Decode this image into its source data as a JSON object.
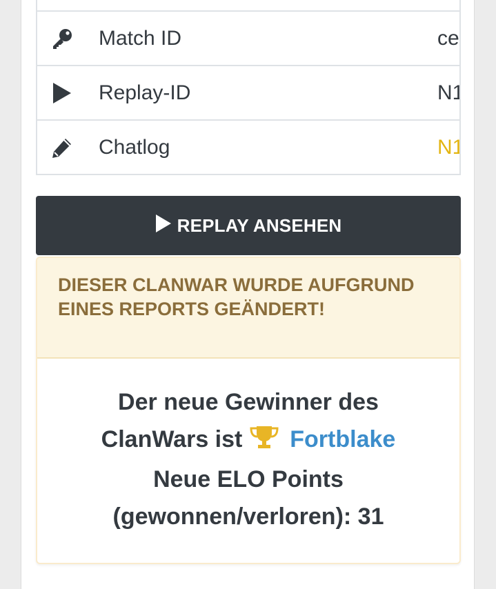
{
  "table": {
    "rows": [
      {
        "icon": "key-icon",
        "label": "Match ID",
        "value": "ce"
      },
      {
        "icon": "play-icon",
        "label": "Replay-ID",
        "value": "N1"
      },
      {
        "icon": "pencil-icon",
        "label": "Chatlog",
        "value": "N1",
        "value_color": "#e3b512"
      }
    ]
  },
  "replay_button": {
    "label": "REPLAY ANSEHEN",
    "icon": "play-icon"
  },
  "alert": {
    "heading": "DIESER CLANWAR WURDE AUFGRUND EINES REPORTS GEÄNDERT!",
    "line1": "Der neue Gewinner des",
    "line2_prefix": "ClanWars ist",
    "trophy_icon": "trophy-icon",
    "winner": "Fortblake",
    "line3": "Neue ELO Points",
    "line4": "(gewonnen/verloren): 31"
  },
  "colors": {
    "dark": "#343a40",
    "link": "#3c8dcb",
    "warning_text": "#8a6d3b",
    "warning_bg": "#fcf5e1",
    "trophy": "#e8b526"
  }
}
